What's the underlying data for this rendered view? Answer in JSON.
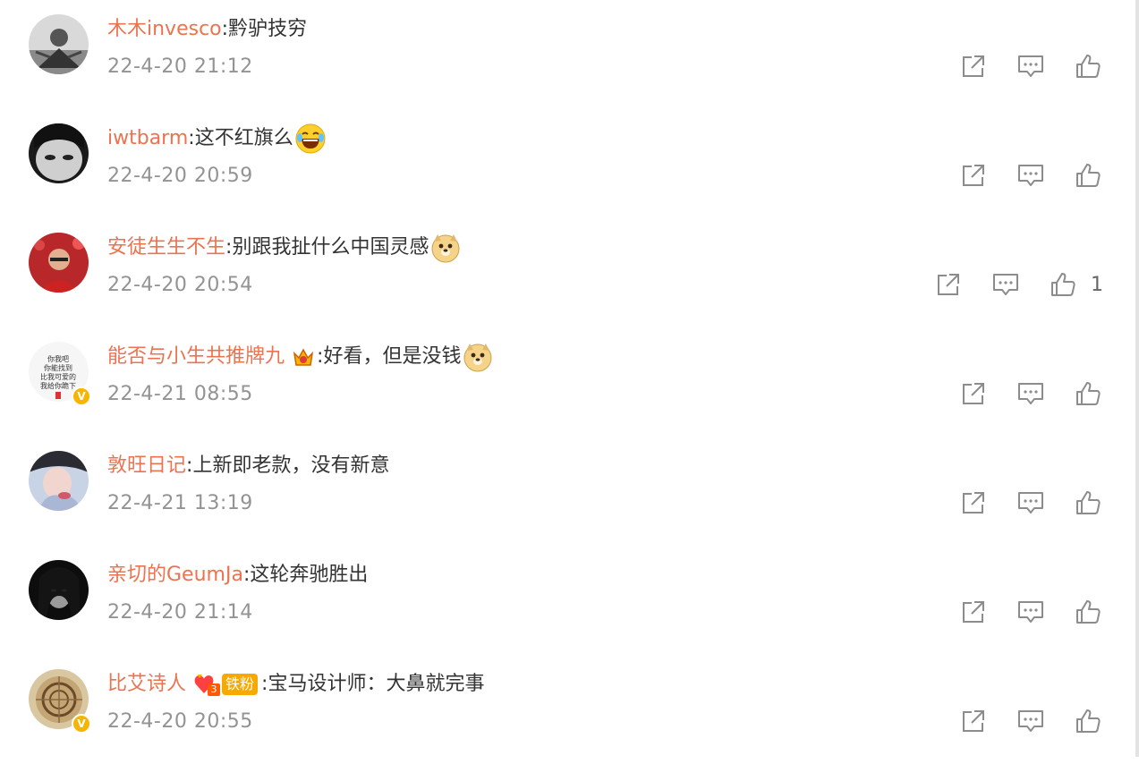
{
  "comments": [
    {
      "user": "木木invesco",
      "text": "黔驴技穷",
      "time": "22-4-20 21:12",
      "emoji": "",
      "like_count": "",
      "verified": false,
      "crown": false,
      "fan_badge": ""
    },
    {
      "user": "iwtbarm",
      "text": "这不红旗么",
      "time": "22-4-20 20:59",
      "emoji": "laugh-cry",
      "like_count": "",
      "verified": false,
      "crown": false,
      "fan_badge": ""
    },
    {
      "user": "安徒生生不生",
      "text": "别跟我扯什么中国灵感",
      "time": "22-4-20 20:54",
      "emoji": "doge",
      "like_count": "1",
      "verified": false,
      "crown": false,
      "fan_badge": ""
    },
    {
      "user": "能否与小生共推牌九",
      "text": "好看，但是没钱",
      "time": "22-4-21 08:55",
      "emoji": "doge",
      "like_count": "",
      "verified": true,
      "crown": true,
      "fan_badge": ""
    },
    {
      "user": "敦旺日记",
      "text": "上新即老款，没有新意",
      "time": "22-4-21 13:19",
      "emoji": "",
      "like_count": "",
      "verified": false,
      "crown": false,
      "fan_badge": ""
    },
    {
      "user": "亲切的GeumJa",
      "text": "这轮奔驰胜出",
      "time": "22-4-20 21:14",
      "emoji": "",
      "like_count": "",
      "verified": false,
      "crown": false,
      "fan_badge": ""
    },
    {
      "user": "比艾诗人",
      "text": "宝马设计师：大鼻就完事",
      "time": "22-4-20 20:55",
      "emoji": "",
      "like_count": "",
      "verified": true,
      "crown": false,
      "fan_badge": "铁粉",
      "fan_level": "3"
    }
  ],
  "separator": ":",
  "avatar4_text": "你我吧 你能找到 比我可爱的 我给你跪下",
  "verified_mark": "V",
  "icons": {
    "share": "share-icon",
    "comment": "comment-icon",
    "like": "like-icon"
  }
}
